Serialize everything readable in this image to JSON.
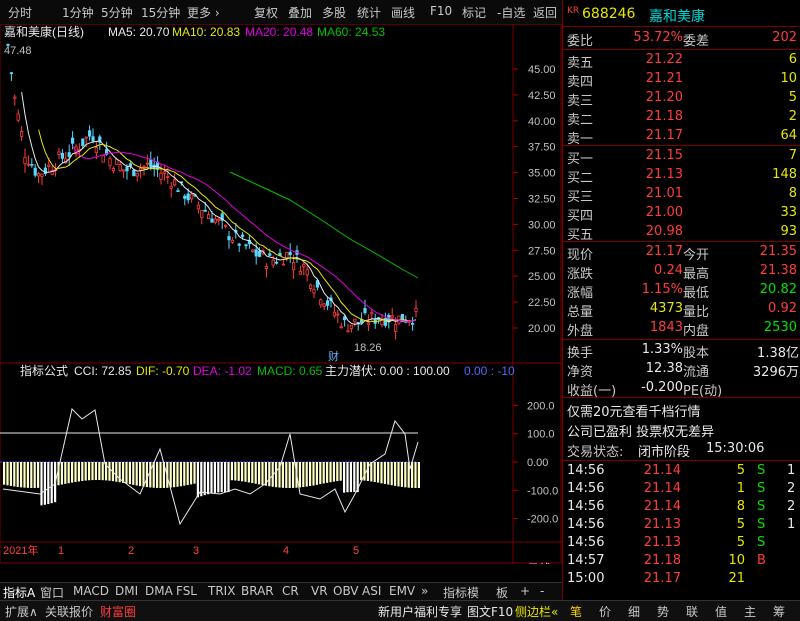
{
  "toolbar": {
    "items": [
      "分时",
      "1分钟",
      "5分钟",
      "15分钟",
      "更多 ›",
      "复权",
      "叠加",
      "多股",
      "统计",
      "画线",
      "F10",
      "标记",
      "-自选",
      "返回"
    ]
  },
  "chart": {
    "title": "嘉和美康(日线)",
    "ma": {
      "ma5": "MA5: 20.70",
      "ma10": "MA10: 20.83",
      "ma20": "MA20: 20.48",
      "ma60": "MA60: 24.53"
    },
    "high_label": "47.48",
    "low_label": "18.26",
    "event_label": "财",
    "y_ticks": [
      "45.00",
      "42.50",
      "40.00",
      "37.50",
      "35.00",
      "32.50",
      "30.00",
      "27.50",
      "25.00",
      "22.50",
      "20.00"
    ],
    "indicator_bar": {
      "name": "指标公式",
      "cci": "CCI: 72.85",
      "dif": "DIF: -0.70",
      "dea": "DEA: -1.02",
      "macd": "MACD: 0.65",
      "main": "主力潜伏: 0.00 : 100.00",
      "extra": "0.00 : -10"
    },
    "ind_ticks": [
      "200.0",
      "100.0",
      "0.00",
      "-100.0",
      "-200.0"
    ],
    "x_labels": [
      "2021年",
      "1",
      "2",
      "3",
      "4",
      "5"
    ],
    "kline_label": "日线"
  },
  "colors": {
    "ma5": "#e8e8e8",
    "ma10": "#e6e600",
    "ma20": "#e000e0",
    "ma60": "#00c000",
    "up": "#ff3c3c",
    "down": "#54d8ff",
    "grid": "#6a0000"
  },
  "quote": {
    "code": "688246",
    "name": "嘉和美康",
    "badge": "KR",
    "weibi_label": "委比",
    "weibi": "53.72%",
    "weicha_label": "委差",
    "weicha": "202",
    "sells": [
      {
        "label": "卖五",
        "price": "21.22",
        "vol": "6"
      },
      {
        "label": "卖四",
        "price": "21.21",
        "vol": "10"
      },
      {
        "label": "卖三",
        "price": "21.20",
        "vol": "5"
      },
      {
        "label": "卖二",
        "price": "21.18",
        "vol": "2"
      },
      {
        "label": "卖一",
        "price": "21.17",
        "vol": "64"
      }
    ],
    "buys": [
      {
        "label": "买一",
        "price": "21.15",
        "vol": "7"
      },
      {
        "label": "买二",
        "price": "21.13",
        "vol": "148"
      },
      {
        "label": "买三",
        "price": "21.01",
        "vol": "8"
      },
      {
        "label": "买四",
        "price": "21.00",
        "vol": "33"
      },
      {
        "label": "买五",
        "price": "20.98",
        "vol": "93"
      }
    ],
    "stats": [
      {
        "l1": "现价",
        "v1": "21.17",
        "c1": "red",
        "l2": "今开",
        "v2": "21.35",
        "c2": "red"
      },
      {
        "l1": "涨跌",
        "v1": "0.24",
        "c1": "red",
        "l2": "最高",
        "v2": "21.38",
        "c2": "red"
      },
      {
        "l1": "涨幅",
        "v1": "1.15%",
        "c1": "red",
        "l2": "最低",
        "v2": "20.82",
        "c2": "grn"
      },
      {
        "l1": "总量",
        "v1": "4373",
        "c1": "yel",
        "l2": "量比",
        "v2": "0.92",
        "c2": "red"
      },
      {
        "l1": "外盘",
        "v1": "1843",
        "c1": "red",
        "l2": "内盘",
        "v2": "2530",
        "c2": "grn"
      }
    ],
    "stats2": [
      {
        "l1": "换手",
        "v1": "1.33%",
        "l2": "股本",
        "v2": "1.38亿"
      },
      {
        "l1": "净资",
        "v1": "12.38",
        "l2": "流通",
        "v2": "3296万"
      },
      {
        "l1": "收益(一)",
        "v1": "-0.200",
        "l2": "PE(动)",
        "v2": ""
      }
    ],
    "notice1": "仅需20元查看千档行情",
    "notice2": "公司已盈利 投票权无差异",
    "status_label": "交易状态:",
    "status": "闭市阶段",
    "status_time": "15:30:06",
    "ticks": [
      {
        "t": "14:56",
        "p": "21.14",
        "v": "5",
        "s": "S"
      },
      {
        "t": "14:56",
        "p": "21.14",
        "v": "1",
        "s": "S"
      },
      {
        "t": "14:56",
        "p": "21.14",
        "v": "8",
        "s": "S"
      },
      {
        "t": "14:56",
        "p": "21.13",
        "v": "5",
        "s": "S"
      },
      {
        "t": "14:56",
        "p": "21.13",
        "v": "5",
        "s": "S"
      },
      {
        "t": "14:57",
        "p": "21.18",
        "v": "10",
        "s": "B"
      },
      {
        "t": "15:00",
        "p": "21.17",
        "v": "21",
        "s": ""
      }
    ],
    "tick_extra": [
      "1",
      "2",
      "2",
      "1",
      "",
      ""
    ]
  },
  "tabs": {
    "row1": [
      "指标A",
      "窗口",
      "MACD",
      "DMI",
      "DMA",
      "FSL",
      "TRIX",
      "BRAR",
      "CR",
      "VR",
      "OBV",
      "ASI",
      "EMV",
      "»",
      "指标模",
      "板",
      "+",
      "-"
    ],
    "row2": [
      "扩展∧",
      "关联报价",
      "财富圈",
      "新用户福利专享",
      "图文F10",
      "侧边栏«"
    ],
    "panel": [
      "笔",
      "价",
      "细",
      "势",
      "联",
      "值",
      "主",
      "筹"
    ]
  }
}
